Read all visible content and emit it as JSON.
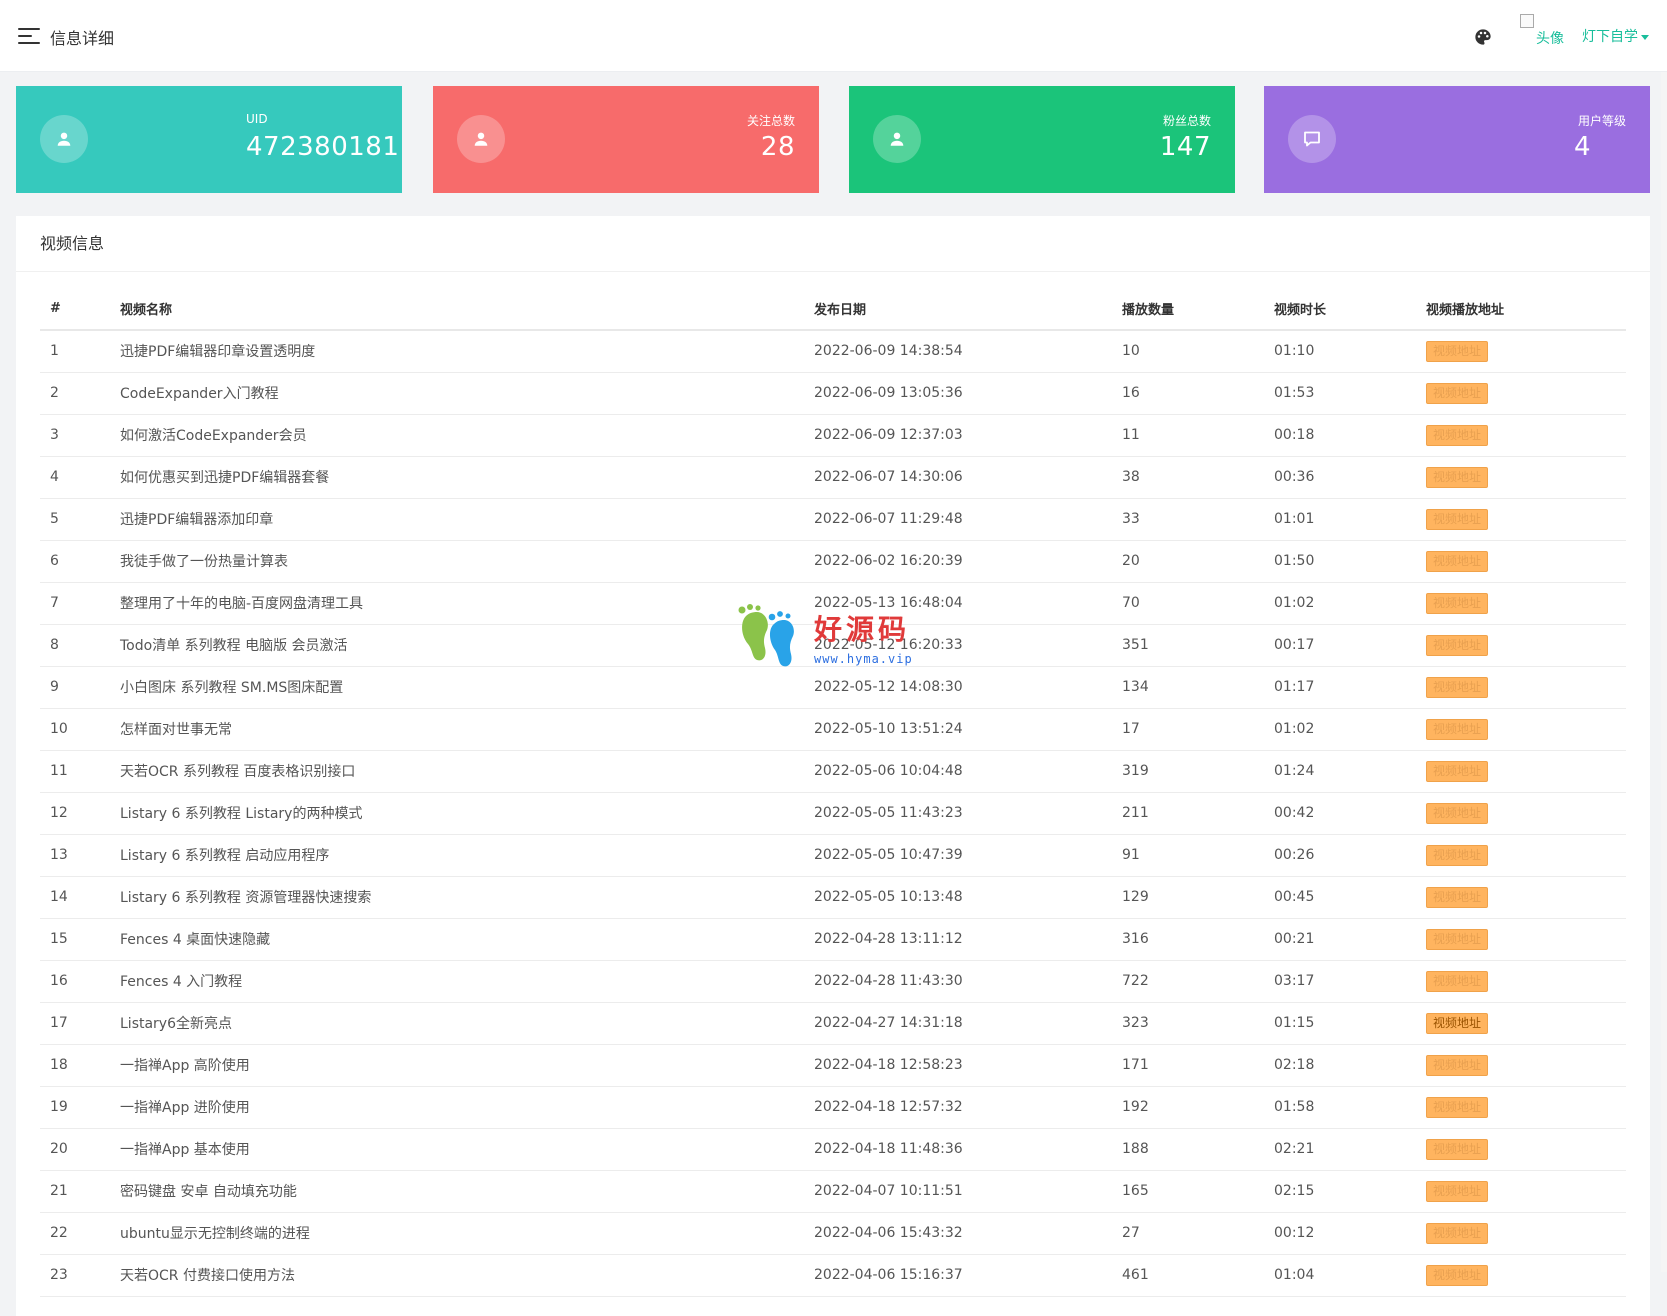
{
  "header": {
    "title": "信息详细",
    "avatar_alt": "头像",
    "user_name": "灯下自学"
  },
  "stats": {
    "uid": {
      "label": "UID",
      "value": "472380181"
    },
    "following": {
      "label": "关注总数",
      "value": "28"
    },
    "fans": {
      "label": "粉丝总数",
      "value": "147"
    },
    "level": {
      "label": "用户等级",
      "value": "4"
    }
  },
  "colors": {
    "uid_card": "#36c9bd",
    "following_card": "#f76b6b",
    "fans_card": "#1bc47a",
    "level_card": "#9a6ee0",
    "accent": "#19be9b",
    "button": "#ffb45f"
  },
  "watermark": {
    "text": "好源码",
    "url": "www.hyma.vip"
  },
  "video_panel": {
    "title": "视频信息",
    "columns": [
      "#",
      "视频名称",
      "发布日期",
      "播放数量",
      "视频时长",
      "视频播放地址"
    ],
    "button_label": "视频地址",
    "rows": [
      [
        "1",
        "迅捷PDF编辑器印章设置透明度",
        "2022-06-09 14:38:54",
        "10",
        "01:10"
      ],
      [
        "2",
        "CodeExpander入门教程",
        "2022-06-09 13:05:36",
        "16",
        "01:53"
      ],
      [
        "3",
        "如何激活CodeExpander会员",
        "2022-06-09 12:37:03",
        "11",
        "00:18"
      ],
      [
        "4",
        "如何优惠买到迅捷PDF编辑器套餐",
        "2022-06-07 14:30:06",
        "38",
        "00:36"
      ],
      [
        "5",
        "迅捷PDF编辑器添加印章",
        "2022-06-07 11:29:48",
        "33",
        "01:01"
      ],
      [
        "6",
        "我徒手做了一份热量计算表",
        "2022-06-02 16:20:39",
        "20",
        "01:50"
      ],
      [
        "7",
        "整理用了十年的电脑-百度网盘清理工具",
        "2022-05-13 16:48:04",
        "70",
        "01:02"
      ],
      [
        "8",
        "Todo清单 系列教程 电脑版 会员激活",
        "2022-05-12 16:20:33",
        "351",
        "00:17"
      ],
      [
        "9",
        "小白图床 系列教程 SM.MS图床配置",
        "2022-05-12 14:08:30",
        "134",
        "01:17"
      ],
      [
        "10",
        "怎样面对世事无常",
        "2022-05-10 13:51:24",
        "17",
        "01:02"
      ],
      [
        "11",
        "天若OCR 系列教程 百度表格识别接口",
        "2022-05-06 10:04:48",
        "319",
        "01:24"
      ],
      [
        "12",
        "Listary 6 系列教程 Listary的两种模式",
        "2022-05-05 11:43:23",
        "211",
        "00:42"
      ],
      [
        "13",
        "Listary 6 系列教程 启动应用程序",
        "2022-05-05 10:47:39",
        "91",
        "00:26"
      ],
      [
        "14",
        "Listary 6 系列教程 资源管理器快速搜索",
        "2022-05-05 10:13:48",
        "129",
        "00:45"
      ],
      [
        "15",
        "Fences 4 桌面快速隐藏",
        "2022-04-28 13:11:12",
        "316",
        "00:21"
      ],
      [
        "16",
        "Fences 4 入门教程",
        "2022-04-28 11:43:30",
        "722",
        "03:17"
      ],
      [
        "17",
        "Listary6全新亮点",
        "2022-04-27 14:31:18",
        "323",
        "01:15"
      ],
      [
        "18",
        "一指禅App 高阶使用",
        "2022-04-18 12:58:23",
        "171",
        "02:18"
      ],
      [
        "19",
        "一指禅App 进阶使用",
        "2022-04-18 12:57:32",
        "192",
        "01:58"
      ],
      [
        "20",
        "一指禅App 基本使用",
        "2022-04-18 11:48:36",
        "188",
        "02:21"
      ],
      [
        "21",
        "密码键盘 安卓 自动填充功能",
        "2022-04-07 10:11:51",
        "165",
        "02:15"
      ],
      [
        "22",
        "ubuntu显示无控制终端的进程",
        "2022-04-06 15:43:32",
        "27",
        "00:12"
      ],
      [
        "23",
        "天若OCR 付费接口使用方法",
        "2022-04-06 15:16:37",
        "461",
        "01:04"
      ]
    ]
  }
}
